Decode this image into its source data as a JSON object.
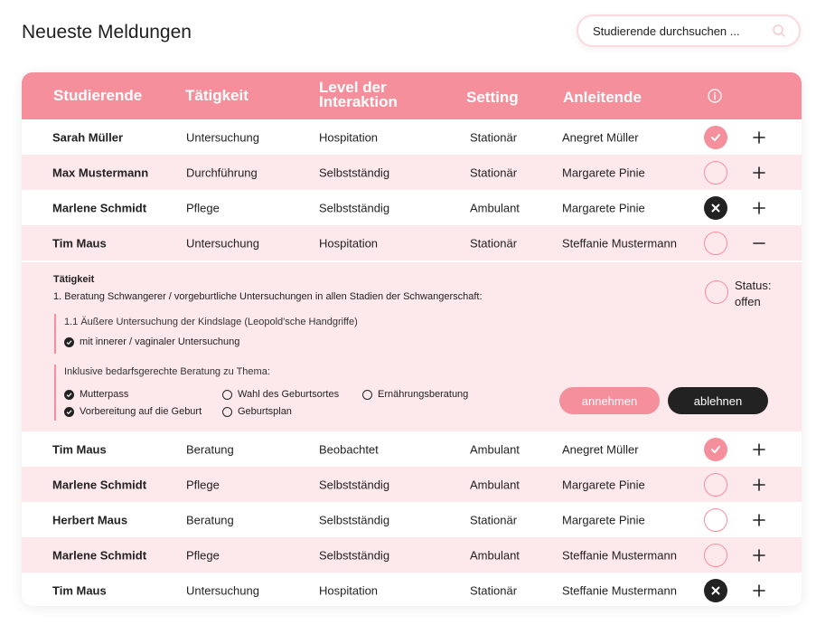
{
  "header": {
    "title": "Neueste Meldungen",
    "search_placeholder": "Studierende durchsuchen ..."
  },
  "table": {
    "columns": {
      "student": "Studierende",
      "activity": "Tätigkeit",
      "level": "Level der Interaktion",
      "setting": "Setting",
      "supervisor": "Anleitende"
    },
    "rows": [
      {
        "student": "Sarah Müller",
        "activity": "Untersuchung",
        "level": "Hospitation",
        "setting": "Stationär",
        "supervisor": "Anegret Müller",
        "status": "accepted",
        "expand": "plus"
      },
      {
        "student": "Max Mustermann",
        "activity": "Durchführung",
        "level": "Selbstständig",
        "setting": "Stationär",
        "supervisor": "Margarete Pinie",
        "status": "open",
        "expand": "plus"
      },
      {
        "student": "Marlene Schmidt",
        "activity": "Pflege",
        "level": "Selbstständig",
        "setting": "Ambulant",
        "supervisor": "Margarete Pinie",
        "status": "rejected",
        "expand": "plus"
      },
      {
        "student": "Tim Maus",
        "activity": "Untersuchung",
        "level": "Hospitation",
        "setting": "Stationär",
        "supervisor": "Steffanie Mustermann",
        "status": "open",
        "expand": "minus"
      },
      {
        "student": "Tim Maus",
        "activity": "Beratung",
        "level": "Beobachtet",
        "setting": "Ambulant",
        "supervisor": "Anegret Müller",
        "status": "accepted",
        "expand": "plus"
      },
      {
        "student": "Marlene Schmidt",
        "activity": "Pflege",
        "level": "Selbstständig",
        "setting": "Ambulant",
        "supervisor": "Margarete Pinie",
        "status": "open",
        "expand": "plus"
      },
      {
        "student": "Herbert Maus",
        "activity": "Beratung",
        "level": "Selbstständig",
        "setting": "Stationär",
        "supervisor": "Margarete Pinie",
        "status": "open",
        "expand": "plus"
      },
      {
        "student": "Marlene Schmidt",
        "activity": "Pflege",
        "level": "Selbstständig",
        "setting": "Ambulant",
        "supervisor": "Steffanie Mustermann",
        "status": "open",
        "expand": "plus"
      },
      {
        "student": "Tim Maus",
        "activity": "Untersuchung",
        "level": "Hospitation",
        "setting": "Stationär",
        "supervisor": "Steffanie Mustermann",
        "status": "rejected",
        "expand": "plus"
      }
    ]
  },
  "detail": {
    "title": "Tätigkeit",
    "heading": "1. Beratung Schwangerer / vorgeburtliche Untersuchungen in allen Stadien der Schwangerschaft:",
    "sub_item": "1.1 Äußere Untersuchung der Kindslage (Leopold'sche Handgriffe)",
    "sub_check": "mit innerer / vaginaler Untersuchung",
    "consult_label": "Inklusive bedarfsgerechte Beratung zu Thema:",
    "options": [
      {
        "label": "Mutterpass",
        "checked": true
      },
      {
        "label": "Wahl des Geburtsortes",
        "checked": false
      },
      {
        "label": "Ernährungsberatung",
        "checked": false
      },
      {
        "label": "Vorbereitung auf die Geburt",
        "checked": true
      },
      {
        "label": "Geburtsplan",
        "checked": false
      }
    ],
    "status_label": "Status:",
    "status_value": "offen",
    "accept_label": "annehmen",
    "reject_label": "ablehnen"
  },
  "colors": {
    "accent": "#f58f9c",
    "accent_light": "#fde8ec",
    "dark": "#222222"
  }
}
